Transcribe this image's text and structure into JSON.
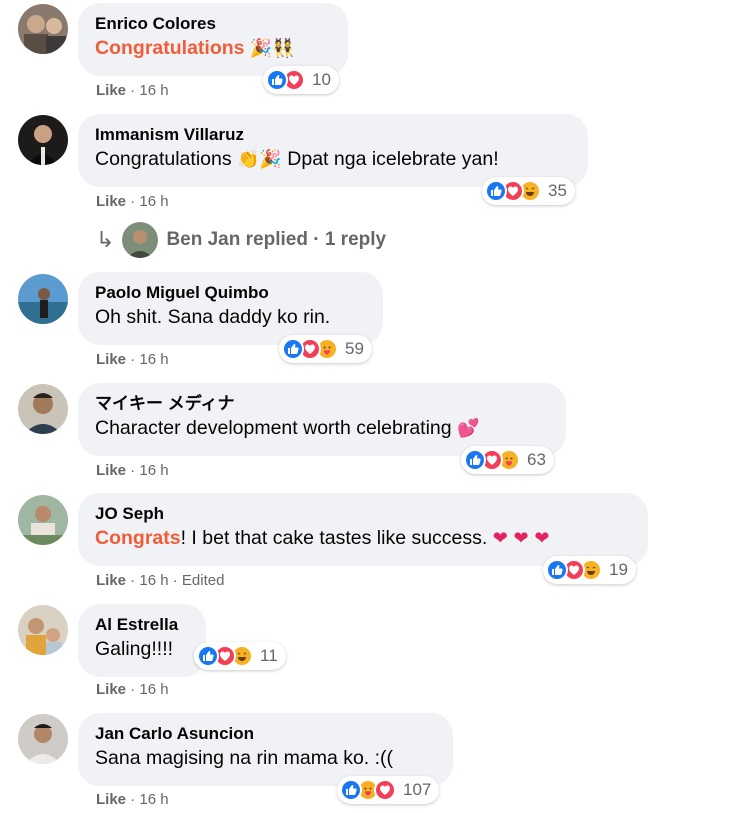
{
  "comments": [
    {
      "author": "Enrico Colores",
      "text_highlight": "Congratulations",
      "text_plain": "",
      "text_emoji": "🎉👯",
      "reactions": [
        "like",
        "love"
      ],
      "reaction_count": "10",
      "like_label": "Like",
      "time": "16 h"
    },
    {
      "author": "Immanism Villaruz",
      "text_highlight": "",
      "text_plain": "Congratulations",
      "text_emoji": "👏🎉",
      "text_after": "Dpat nga icelebrate yan!",
      "reactions": [
        "like",
        "love",
        "haha"
      ],
      "reaction_count": "35",
      "like_label": "Like",
      "time": "16 h",
      "replies": {
        "label": "Ben Jan replied",
        "count": "1 reply"
      }
    },
    {
      "author": "Paolo Miguel Quimbo",
      "text_plain": "Oh shit. Sana daddy ko rin.",
      "reactions": [
        "like",
        "love",
        "care"
      ],
      "reaction_count": "59",
      "like_label": "Like",
      "time": "16 h"
    },
    {
      "author": "マイキー メディナ",
      "text_plain": "Character development worth celebrating",
      "text_emoji": "💕",
      "reactions": [
        "like",
        "love",
        "care"
      ],
      "reaction_count": "63",
      "like_label": "Like",
      "time": "16 h"
    },
    {
      "author": "JO Seph",
      "text_highlight": "Congrats",
      "text_plain": "! I bet that cake tastes like success.",
      "text_emoji": "❤ ❤ ❤",
      "reactions": [
        "like",
        "love",
        "haha"
      ],
      "reaction_count": "19",
      "like_label": "Like",
      "time": "16 h",
      "edited": "Edited"
    },
    {
      "author": "Al Estrella",
      "text_plain": "Galing!!!!",
      "reactions": [
        "like",
        "love",
        "haha"
      ],
      "reaction_count": "11",
      "like_label": "Like",
      "time": "16 h"
    },
    {
      "author": "Jan Carlo Asuncion",
      "text_plain": "Sana magising na rin mama ko. :((",
      "reactions": [
        "like",
        "care",
        "love"
      ],
      "reaction_count": "107",
      "like_label": "Like",
      "time": "16 h"
    }
  ],
  "colors": {
    "bubble": "#f0f2f5",
    "highlight": "#f25d39",
    "like": "#1877f2",
    "love": "#f33e58",
    "haha": "#f7b125",
    "meta": "#65676b"
  }
}
